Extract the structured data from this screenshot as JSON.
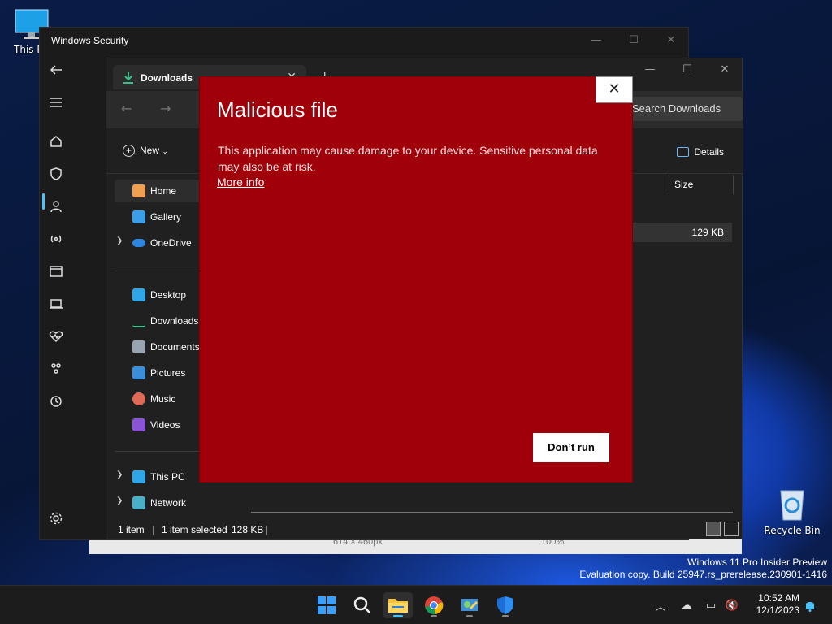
{
  "desktop": {
    "this_pc_label": "This PC",
    "recycle_bin_label": "Recycle Bin",
    "watermark": {
      "line1": "Windows 11 Pro Insider Preview",
      "line2": "Evaluation copy. Build 25947.rs_prerelease.230901-1416"
    }
  },
  "windows_security": {
    "title": "Windows Security",
    "nav_icons": [
      "back-arrow-icon",
      "hamburger-menu-icon",
      "home-icon",
      "shield-icon",
      "account-icon",
      "network-icon",
      "app-browser-icon",
      "device-icon",
      "health-icon",
      "family-icon",
      "history-icon",
      "settings-icon"
    ]
  },
  "explorer": {
    "tab_label": "Downloads",
    "search_placeholder": "Search Downloads",
    "new_label": "New",
    "details_label": "Details",
    "column_size": "Size",
    "file_size": "129 KB",
    "sidebar": [
      {
        "label": "Home",
        "selected": true
      },
      {
        "label": "Gallery"
      },
      {
        "label": "OneDrive",
        "expandable": true
      },
      {
        "label": "Desktop"
      },
      {
        "label": "Downloads"
      },
      {
        "label": "Documents"
      },
      {
        "label": "Pictures"
      },
      {
        "label": "Music"
      },
      {
        "label": "Videos"
      },
      {
        "label": "This PC",
        "expandable": true
      },
      {
        "label": "Network",
        "expandable": true
      }
    ],
    "status": {
      "items": "1 item",
      "selected": "1 item selected",
      "size": "128 KB"
    }
  },
  "viewer_strip": {
    "dimensions": "614 × 460px",
    "zoom": "100%"
  },
  "dialog": {
    "title": "Malicious file",
    "message": "This application may cause damage to your device. Sensitive personal data may also be at risk.",
    "link": "More info",
    "button": "Don’t run"
  },
  "taskbar": {
    "apps": [
      "windows-start-icon",
      "search-icon",
      "file-explorer-icon",
      "chrome-icon",
      "control-panel-icon",
      "windows-security-icon"
    ],
    "time": "10:52 AM",
    "date": "12/1/2023"
  },
  "colors": {
    "dialog_bg": "#a00009",
    "accent": "#4cc2ff"
  }
}
